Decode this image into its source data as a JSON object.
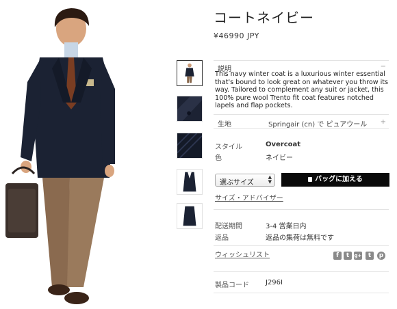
{
  "product": {
    "title": "コートネイビー",
    "price": "¥46990 JPY"
  },
  "thumbnails": [
    {
      "name": "thumb-model-front",
      "active": true
    },
    {
      "name": "thumb-fabric-detail",
      "active": false
    },
    {
      "name": "thumb-fabric-stripe",
      "active": false
    },
    {
      "name": "thumb-coat-flat",
      "active": false
    },
    {
      "name": "thumb-coat-back",
      "active": false
    }
  ],
  "description": {
    "label": "説明",
    "toggle": "−",
    "text": "This navy winter coat is a luxurious winter essential that's bound to look great on whatever you throw its way. Tailored to complement any suit or jacket, this 100% pure wool Trento fit coat features notched lapels and flap pockets."
  },
  "fabric": {
    "label": "生地",
    "value": "Springair (cn) で ピュアウール",
    "toggle": "+"
  },
  "attributes": [
    {
      "label": "スタイル",
      "value": "Overcoat"
    },
    {
      "label": "色",
      "value": "ネイビー"
    }
  ],
  "size_select": {
    "value": "選ぶサイズ"
  },
  "add_to_bag": "バッグに加える",
  "size_advisor": "サイズ・アドバイザー",
  "shipping": [
    {
      "label": "配送期間",
      "value": "3-4 営業日内"
    },
    {
      "label": "返品",
      "value": "返品の集荷は無料です"
    }
  ],
  "wishlist": "ウィッシュリスト",
  "social_icons": [
    "facebook-icon",
    "twitter-icon",
    "google-plus-icon",
    "tumblr-icon",
    "pinterest-icon"
  ],
  "social_glyphs": [
    "f",
    "t",
    "g+",
    "t",
    "p"
  ],
  "product_code": {
    "label": "製品コード",
    "value": "J296I"
  },
  "colors": {
    "coat": "#1b2233",
    "button": "#0a0a0a",
    "social": "#8a8a8a"
  }
}
